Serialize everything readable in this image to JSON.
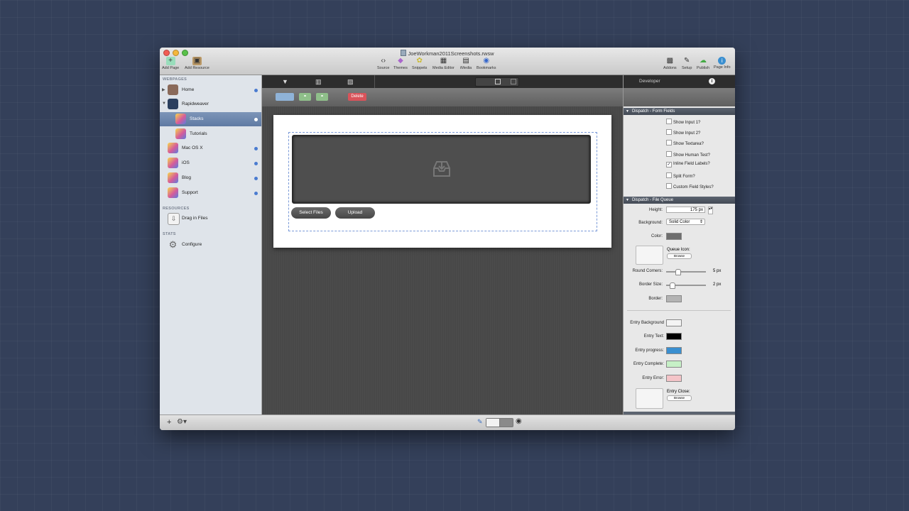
{
  "window": {
    "title": "JoeWorkman2011Screenshots.rwsw"
  },
  "toolbar": {
    "left": [
      {
        "label": "Add Page",
        "icon": "add-page-icon"
      },
      {
        "label": "Add Resource",
        "icon": "add-resource-icon"
      }
    ],
    "center": [
      {
        "label": "Source",
        "icon": "source-icon"
      },
      {
        "label": "Themes",
        "icon": "themes-icon"
      },
      {
        "label": "Snippets",
        "icon": "snippets-icon"
      },
      {
        "label": "Media Editor",
        "icon": "media-editor-icon"
      },
      {
        "label": "iMedia",
        "icon": "imedia-icon"
      },
      {
        "label": "Bookmarks",
        "icon": "bookmarks-icon"
      }
    ],
    "right": [
      {
        "label": "Addons",
        "icon": "addons-icon"
      },
      {
        "label": "Setup",
        "icon": "setup-icon"
      },
      {
        "label": "Publish",
        "icon": "publish-icon"
      },
      {
        "label": "Page Info",
        "icon": "page-info-icon"
      }
    ]
  },
  "sidebar": {
    "webpages_header": "WEBPAGES",
    "pages": [
      {
        "label": "Home",
        "icon": "home-icon"
      },
      {
        "label": "Rapidweaver",
        "icon": "rapidweaver-icon"
      },
      {
        "label": "Stacks",
        "icon": "stacks-icon"
      },
      {
        "label": "Tutorials",
        "icon": "stacks-icon"
      },
      {
        "label": "Mac OS X",
        "icon": "stacks-icon"
      },
      {
        "label": "iOS",
        "icon": "stacks-icon"
      },
      {
        "label": "Blog",
        "icon": "stacks-icon"
      },
      {
        "label": "Support",
        "icon": "stacks-icon"
      }
    ],
    "resources_header": "RESOURCES",
    "resources": [
      {
        "label": "Drag in Files",
        "icon": "download-icon"
      }
    ],
    "stats_header": "STATS",
    "stats": [
      {
        "label": "Configure",
        "icon": "gear-icon"
      }
    ]
  },
  "editor": {
    "buttons": {
      "delete": "Delete"
    },
    "page": {
      "select_files": "Select Files",
      "upload": "Upload"
    }
  },
  "inspector": {
    "header": "Developer",
    "form_fields": {
      "title": "Dispatch - Form Fields",
      "checkboxes": [
        {
          "label": "Show Input 1?",
          "checked": false
        },
        {
          "label": "Show Input 2?",
          "checked": false
        },
        {
          "label": "Show Textarea?",
          "checked": false
        },
        {
          "label": "Show Human Test?",
          "checked": false
        },
        {
          "label": "Inline Field Labels?",
          "checked": true
        },
        {
          "label": "Split Form?",
          "checked": false
        },
        {
          "label": "Custom Field Styles?",
          "checked": false
        }
      ]
    },
    "file_queue": {
      "title": "Dispatch - File Queue",
      "height_label": "Height:",
      "height_value": "175 px",
      "background_label": "Background:",
      "background_value": "Solid Color",
      "color_label": "Color:",
      "color_value": "#6e6e6e",
      "queue_icon_label": "Queue Icon:",
      "browse": "Browse",
      "round_corners_label": "Round Corners:",
      "round_corners_value": "5 px",
      "round_corners_fraction": 0.28,
      "border_size_label": "Border Size:",
      "border_size_value": "2 px",
      "border_size_fraction": 0.1,
      "border_label": "Border:",
      "border_color": "#b3b3b3",
      "entries": [
        {
          "label": "Entry Background",
          "color": "#f4f4f4"
        },
        {
          "label": "Entry Text:",
          "color": "#000000"
        },
        {
          "label": "Entry progress:",
          "color": "#3a8fd0"
        },
        {
          "label": "Entry Complete:",
          "color": "#c6f0c6"
        },
        {
          "label": "Entry Error:",
          "color": "#f4c4c8"
        }
      ],
      "entry_close_label": "Entry Close:",
      "entry_close_browse": "Browse"
    }
  }
}
